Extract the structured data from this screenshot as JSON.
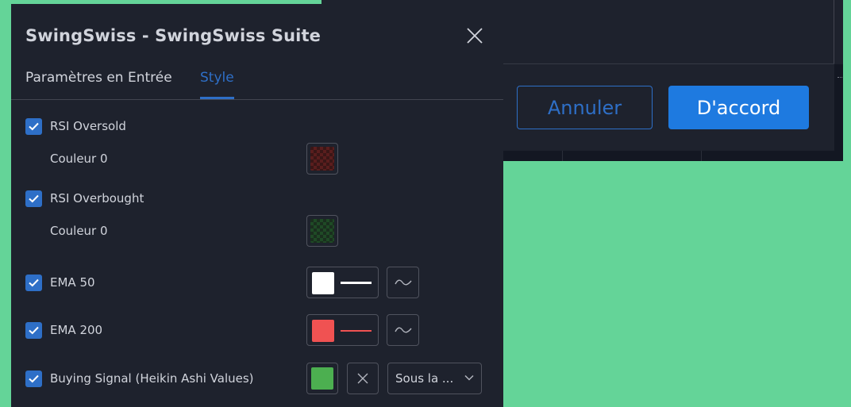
{
  "background_dialog": {
    "cancel_label": "Annuler",
    "ok_label": "D'accord"
  },
  "dialog": {
    "title": "SwingSwiss - SwingSwiss Suite",
    "tabs": [
      {
        "label": "Paramètres en Entrée",
        "active": false
      },
      {
        "label": "Style",
        "active": true
      }
    ],
    "rows": [
      {
        "label": "RSI Oversold",
        "checked": true,
        "sub_label": "Couleur 0",
        "color": "#5a1e1e"
      },
      {
        "label": "RSI Overbought",
        "checked": true,
        "sub_label": "Couleur 0",
        "color": "#1f4a26"
      },
      {
        "label": "EMA 50",
        "checked": true,
        "color": "#ffffff",
        "line_color": "#ffffff",
        "icon": "wave-icon"
      },
      {
        "label": "EMA 200",
        "checked": true,
        "color": "#f05252",
        "line_color": "#f05252",
        "icon": "wave-icon"
      },
      {
        "label": "Buying Signal (Heikin Ashi Values)",
        "checked": true,
        "color": "#4caf50",
        "shape_icon": "x-icon",
        "location": "Sous la ..."
      }
    ]
  },
  "colors": {
    "accent": "#2e6fc7",
    "panel": "#1e222d",
    "backdrop": "#64d498"
  }
}
